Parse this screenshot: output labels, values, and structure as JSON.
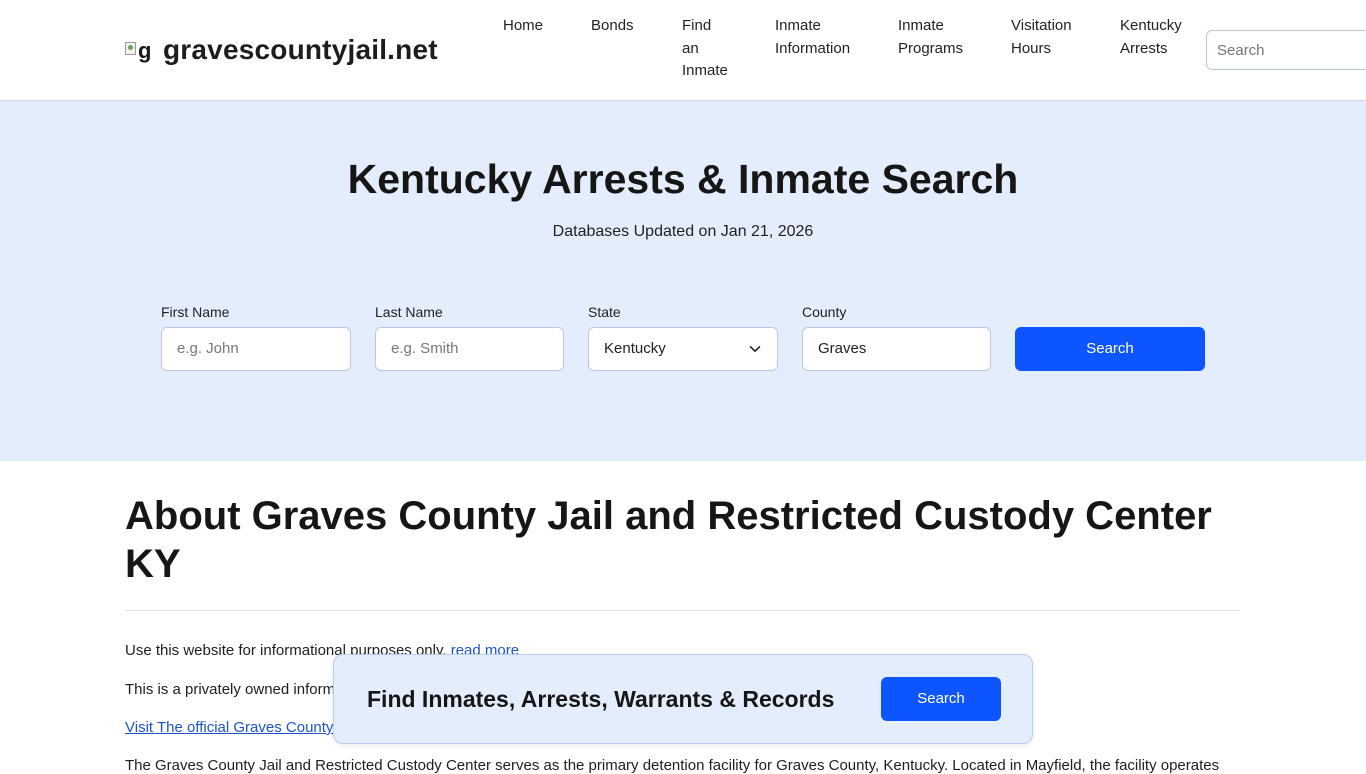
{
  "header": {
    "logo_alt": "g",
    "site_name": "gravescountyjail.net",
    "nav": [
      {
        "label": "Home"
      },
      {
        "label": "Bonds"
      },
      {
        "label": "Find an Inmate"
      },
      {
        "label": "Inmate Information"
      },
      {
        "label": "Inmate Programs"
      },
      {
        "label": "Visitation Hours"
      },
      {
        "label": "Kentucky Arrests"
      }
    ],
    "search_placeholder": "Search"
  },
  "hero": {
    "title": "Kentucky Arrests & Inmate Search",
    "subtitle": "Databases Updated on Jan 21, 2026",
    "fields": {
      "first_name": {
        "label": "First Name",
        "placeholder": "e.g. John"
      },
      "last_name": {
        "label": "Last Name",
        "placeholder": "e.g. Smith"
      },
      "state": {
        "label": "State",
        "value": "Kentucky"
      },
      "county": {
        "label": "County",
        "value": "Graves"
      }
    },
    "search_button": "Search"
  },
  "content": {
    "title": "About Graves County Jail and Restricted Custody Center KY",
    "p1_text": "Use this website for informational purposes only.",
    "p1_link": "read more",
    "p2_text": "This is a privately owned inform",
    "p3_link": "Visit The official Graves County",
    "p4_text": "The Graves County Jail and Restricted Custody Center serves as the primary detention facility for Graves County, Kentucky. Located in Mayfield, the facility operates"
  },
  "floatbar": {
    "text": "Find Inmates, Arrests, Warrants & Records",
    "button": "Search"
  },
  "colors": {
    "accent": "#0d56ff",
    "hero_bg": "#e4edfc",
    "link": "#1a56c8"
  }
}
